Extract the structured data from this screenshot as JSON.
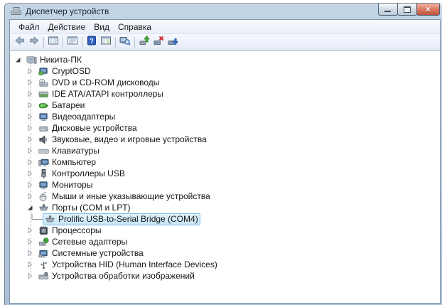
{
  "window": {
    "title": "Диспетчер устройств"
  },
  "menu": {
    "items": [
      {
        "name": "file",
        "label": "Файл"
      },
      {
        "name": "action",
        "label": "Действие"
      },
      {
        "name": "view",
        "label": "Вид"
      },
      {
        "name": "help",
        "label": "Справка"
      }
    ]
  },
  "toolbar": {
    "buttons": [
      {
        "type": "button",
        "name": "back",
        "icon": "back-icon"
      },
      {
        "type": "button",
        "name": "forward",
        "icon": "forward-icon"
      },
      {
        "type": "separator"
      },
      {
        "type": "button",
        "name": "show-console-tree",
        "icon": "console-tree-icon"
      },
      {
        "type": "separator"
      },
      {
        "type": "button",
        "name": "properties",
        "icon": "properties-icon"
      },
      {
        "type": "separator"
      },
      {
        "type": "button",
        "name": "help",
        "icon": "help-icon"
      },
      {
        "type": "button",
        "name": "show-action-pane",
        "icon": "action-pane-icon"
      },
      {
        "type": "separator"
      },
      {
        "type": "button",
        "name": "scan-hardware-changes",
        "icon": "scan-hardware-icon"
      },
      {
        "type": "separator"
      },
      {
        "type": "button",
        "name": "update-driver",
        "icon": "update-driver-icon"
      },
      {
        "type": "button",
        "name": "uninstall-device",
        "icon": "uninstall-icon"
      },
      {
        "type": "button",
        "name": "disable-device",
        "icon": "disable-icon"
      }
    ]
  },
  "tree": {
    "items": [
      {
        "name": "nikita-pc",
        "label": "Никита-ПК",
        "level": 0,
        "expand": "expanded",
        "icon": "pc",
        "selected": false
      },
      {
        "name": "cryptosd",
        "label": "CryptOSD",
        "level": 1,
        "expand": "collapsed",
        "icon": "cryptosd",
        "selected": false
      },
      {
        "name": "dvd-cdrom",
        "label": "DVD и CD-ROM дисководы",
        "level": 1,
        "expand": "collapsed",
        "icon": "dvd",
        "selected": false
      },
      {
        "name": "ide-controllers",
        "label": "IDE ATA/ATAPI контроллеры",
        "level": 1,
        "expand": "collapsed",
        "icon": "ide",
        "selected": false
      },
      {
        "name": "batteries",
        "label": "Батареи",
        "level": 1,
        "expand": "collapsed",
        "icon": "battery",
        "selected": false
      },
      {
        "name": "video-adapters",
        "label": "Видеоадаптеры",
        "level": 1,
        "expand": "collapsed",
        "icon": "monitor",
        "selected": false
      },
      {
        "name": "disk-devices",
        "label": "Дисковые устройства",
        "level": 1,
        "expand": "collapsed",
        "icon": "disk",
        "selected": false
      },
      {
        "name": "sound-devices",
        "label": "Звуковые, видео и игровые устройства",
        "level": 1,
        "expand": "collapsed",
        "icon": "speaker",
        "selected": false
      },
      {
        "name": "keyboards",
        "label": "Клавиатуры",
        "level": 1,
        "expand": "collapsed",
        "icon": "keyboard",
        "selected": false
      },
      {
        "name": "computer",
        "label": "Компьютер",
        "level": 1,
        "expand": "collapsed",
        "icon": "computer2",
        "selected": false
      },
      {
        "name": "usb-controllers",
        "label": "Контроллеры USB",
        "level": 1,
        "expand": "collapsed",
        "icon": "usb",
        "selected": false
      },
      {
        "name": "monitors",
        "label": "Мониторы",
        "level": 1,
        "expand": "collapsed",
        "icon": "monitor",
        "selected": false
      },
      {
        "name": "mice",
        "label": "Мыши и иные указывающие устройства",
        "level": 1,
        "expand": "collapsed",
        "icon": "mouse",
        "selected": false
      },
      {
        "name": "ports",
        "label": "Порты (COM и LPT)",
        "level": 1,
        "expand": "expanded",
        "icon": "serial",
        "selected": false
      },
      {
        "name": "prolific-com4",
        "label": "Prolific USB-to-Serial Bridge (COM4)",
        "level": 2,
        "expand": "none",
        "icon": "serial",
        "selected": true
      },
      {
        "name": "processors",
        "label": "Процессоры",
        "level": 1,
        "expand": "collapsed",
        "icon": "cpu",
        "selected": false
      },
      {
        "name": "network-adapters",
        "label": "Сетевые адаптеры",
        "level": 1,
        "expand": "collapsed",
        "icon": "network",
        "selected": false
      },
      {
        "name": "system-devices",
        "label": "Системные устройства",
        "level": 1,
        "expand": "collapsed",
        "icon": "system",
        "selected": false
      },
      {
        "name": "hid-devices",
        "label": "Устройства HID (Human Interface Devices)",
        "level": 1,
        "expand": "collapsed",
        "icon": "hid",
        "selected": false
      },
      {
        "name": "imaging-devices",
        "label": "Устройства обработки изображений",
        "level": 1,
        "expand": "collapsed",
        "icon": "imaging",
        "selected": false
      }
    ]
  },
  "colors": {
    "titlebar": "#aac3da",
    "selection_fill": "#cbe6f8",
    "selection_border": "#7fc1e8",
    "toolbar_divider": "#98a2ad"
  }
}
